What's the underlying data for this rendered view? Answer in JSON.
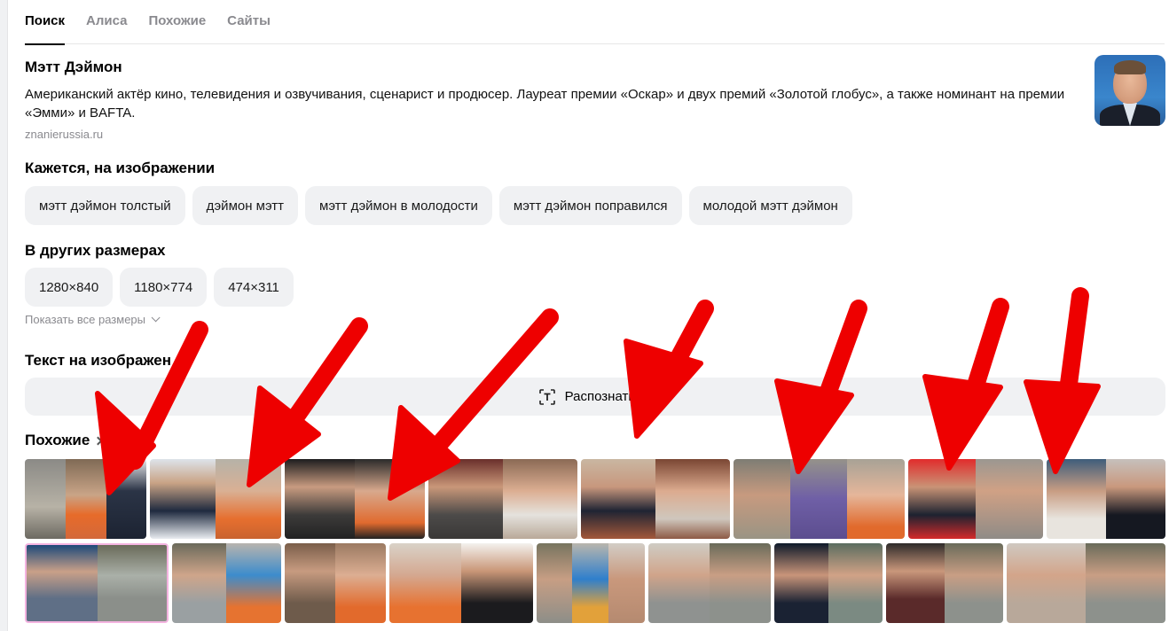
{
  "tabs": [
    {
      "label": "Поиск",
      "active": true
    },
    {
      "label": "Алиса",
      "active": false
    },
    {
      "label": "Похожие",
      "active": false
    },
    {
      "label": "Сайты",
      "active": false
    }
  ],
  "entity": {
    "title": "Мэтт Дэймон",
    "description": "Американский актёр кино, телевидения и озвучивания, сценарист и продюсер. Лауреат премии «Оскар» и двух премий «Золотой глобус», а также номинант на премии «Эмми» и BAFTA.",
    "source": "znanierussia.ru"
  },
  "seems": {
    "title": "Кажется, на изображении",
    "chips": [
      "мэтт дэймон толстый",
      "дэймон мэтт",
      "мэтт дэймон в молодости",
      "мэтт дэймон поправился",
      "молодой мэтт дэймон"
    ]
  },
  "sizes": {
    "title": "В других размерах",
    "chips": [
      "1280×840",
      "1180×774",
      "474×311"
    ],
    "show_all": "Показать все размеры"
  },
  "text_on_image": {
    "title": "Текст на изображен",
    "button_label": "Распознать те"
  },
  "similar": {
    "title": "Похожие"
  },
  "colors": {
    "accent_arrow": "#ee0000",
    "chip_bg": "#f0f1f3",
    "highlight_border": "#f4b3e0",
    "muted_text": "#8a8a8f"
  },
  "icons": {
    "ocr": "text-recognize-icon",
    "chevron": "chevron-down-icon",
    "similar_chevron": "chevron-right-icon"
  }
}
